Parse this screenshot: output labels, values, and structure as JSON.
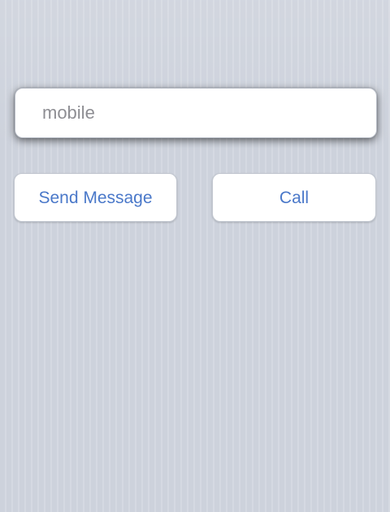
{
  "contact_form": {
    "mobile_input": {
      "value": "",
      "placeholder": "mobile"
    },
    "actions": {
      "send_message_label": "Send Message",
      "call_label": "Call"
    }
  },
  "colors": {
    "background": "#cdd2dc",
    "card": "#ffffff",
    "button_text": "#4a78c9",
    "placeholder_text": "#8e8e93"
  }
}
